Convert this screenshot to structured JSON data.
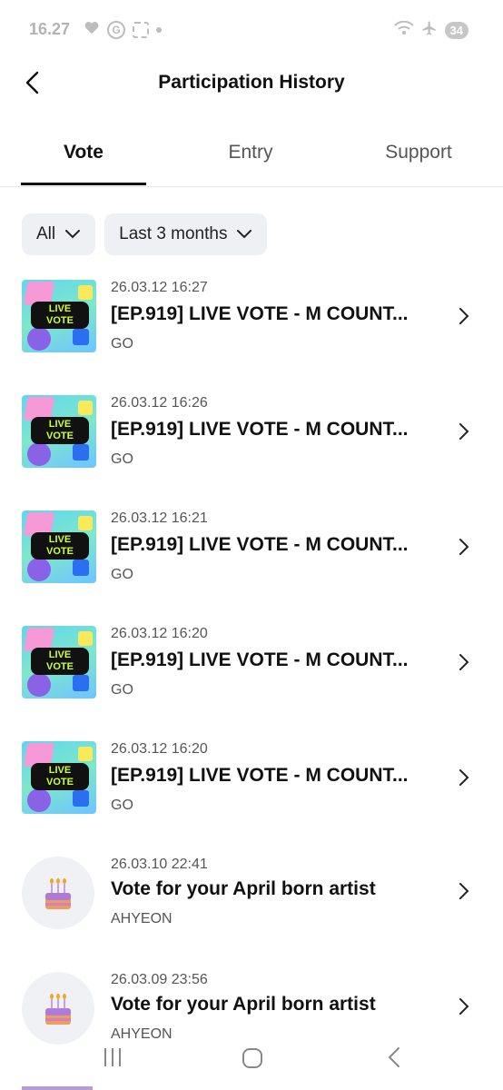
{
  "status_bar": {
    "time": "16.27",
    "battery": "34"
  },
  "header": {
    "title": "Participation History"
  },
  "tabs": [
    {
      "label": "Vote",
      "active": true
    },
    {
      "label": "Entry",
      "active": false
    },
    {
      "label": "Support",
      "active": false
    }
  ],
  "filters": {
    "type": "All",
    "period": "Last 3 months"
  },
  "items": [
    {
      "date": "26.03.12 16:27",
      "title": "[EP.919] LIVE VOTE - M COUNT...",
      "subtitle": "GO",
      "thumb": "live-vote",
      "thumb_text": [
        "LIVE",
        "VOTE"
      ]
    },
    {
      "date": "26.03.12 16:26",
      "title": "[EP.919] LIVE VOTE - M COUNT...",
      "subtitle": "GO",
      "thumb": "live-vote",
      "thumb_text": [
        "LIVE",
        "VOTE"
      ]
    },
    {
      "date": "26.03.12 16:21",
      "title": "[EP.919] LIVE VOTE - M COUNT...",
      "subtitle": "GO",
      "thumb": "live-vote",
      "thumb_text": [
        "LIVE",
        "VOTE"
      ]
    },
    {
      "date": "26.03.12 16:20",
      "title": "[EP.919] LIVE VOTE - M COUNT...",
      "subtitle": "GO",
      "thumb": "live-vote",
      "thumb_text": [
        "LIVE",
        "VOTE"
      ]
    },
    {
      "date": "26.03.12 16:20",
      "title": "[EP.919] LIVE VOTE - M COUNT...",
      "subtitle": "GO",
      "thumb": "live-vote",
      "thumb_text": [
        "LIVE",
        "VOTE"
      ]
    },
    {
      "date": "26.03.10 22:41",
      "title": "Vote for your April born artist",
      "subtitle": "AHYEON",
      "thumb": "cake"
    },
    {
      "date": "26.03.09 23:56",
      "title": "Vote for your April born artist",
      "subtitle": "AHYEON",
      "thumb": "cake"
    }
  ],
  "colors": {
    "accent": "#111111",
    "pill_bg": "#eef0f3",
    "live_label": "#ccff3a"
  }
}
